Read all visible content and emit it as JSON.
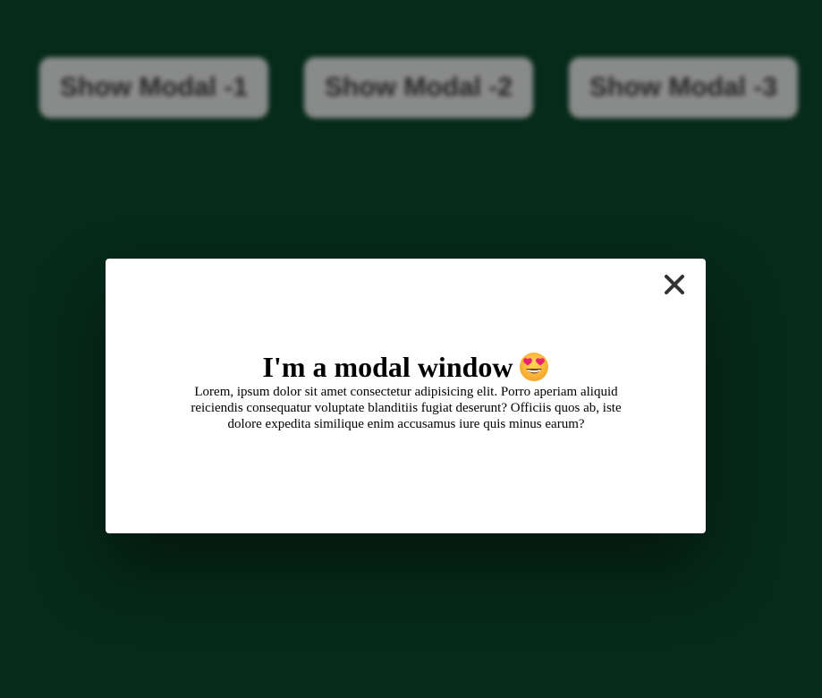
{
  "buttons": [
    {
      "label": "Show Modal -1"
    },
    {
      "label": "Show Modal -2"
    },
    {
      "label": "Show Modal -3"
    }
  ],
  "modal": {
    "title": "I'm a modal window",
    "emoji_icon": "heart-eyes-emoji-icon",
    "close_icon": "close-icon",
    "body": "Lorem, ipsum dolor sit amet consectetur adipisicing elit. Porro aperiam aliquid reiciendis consequatur voluptate blanditiis fugiat deserunt? Officiis quos ab, iste dolore expedita similique enim accusamus iure quis minus earum?"
  },
  "colors": {
    "background": "#07301f",
    "button_bg": "#9d9f9e",
    "modal_bg": "#ffffff"
  }
}
